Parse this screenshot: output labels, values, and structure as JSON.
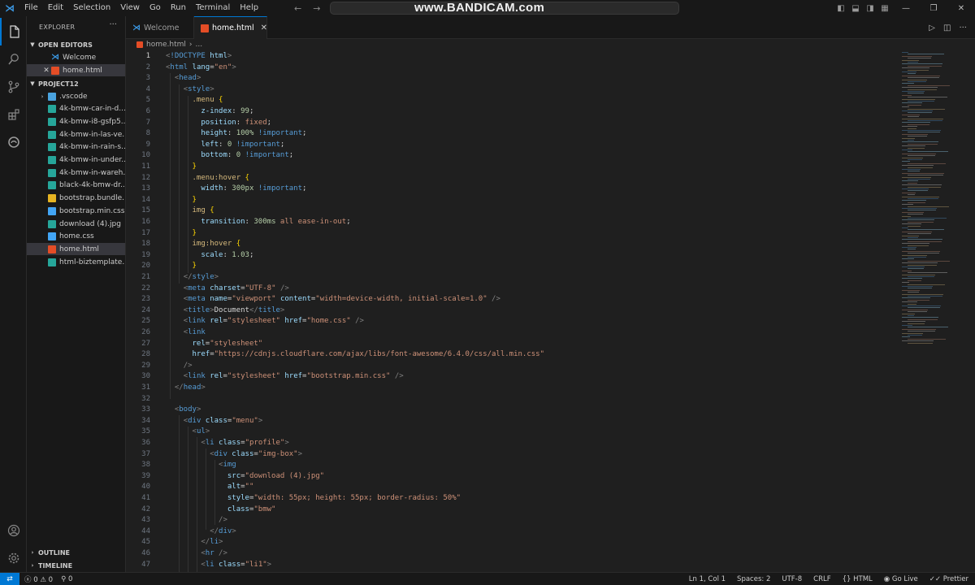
{
  "watermark": "www.BANDICAM.com",
  "menu": [
    "File",
    "Edit",
    "Selection",
    "View",
    "Go",
    "Run",
    "Terminal",
    "Help"
  ],
  "colors": {
    "accent": "#0078d4",
    "editor_bg": "#1f1f1f",
    "chrome_bg": "#181818"
  },
  "icons": {
    "activity": [
      "explorer-icon",
      "search-icon",
      "source-control-icon",
      "extensions-icon",
      "edge-icon",
      "account-icon",
      "settings-gear-icon"
    ]
  },
  "sidebar": {
    "title": "EXPLORER",
    "more": "···",
    "open_editors_label": "OPEN EDITORS",
    "open_editors": [
      {
        "name": "Welcome",
        "icon": "vscode-icon",
        "close": ""
      },
      {
        "name": "home.html",
        "icon": "html-file-icon",
        "close": "✕"
      }
    ],
    "project_label": "PROJECT12",
    "files": [
      {
        "name": ".vscode",
        "kind": "folder"
      },
      {
        "name": "4k-bmw-car-in-d...",
        "kind": "jpg"
      },
      {
        "name": "4k-bmw-i8-gsfp5...",
        "kind": "jpg"
      },
      {
        "name": "4k-bmw-in-las-ve...",
        "kind": "jpg"
      },
      {
        "name": "4k-bmw-in-rain-s...",
        "kind": "jpg"
      },
      {
        "name": "4k-bmw-in-under...",
        "kind": "jpg"
      },
      {
        "name": "4k-bmw-in-wareh...",
        "kind": "jpg"
      },
      {
        "name": "black-4k-bmw-dr...",
        "kind": "jpg"
      },
      {
        "name": "bootstrap.bundle....",
        "kind": "js"
      },
      {
        "name": "bootstrap.min.css",
        "kind": "css"
      },
      {
        "name": "download (4).jpg",
        "kind": "jpg"
      },
      {
        "name": "home.css",
        "kind": "css"
      },
      {
        "name": "home.html",
        "kind": "html"
      },
      {
        "name": "html-biztemplate....",
        "kind": "jpg"
      }
    ],
    "outline_label": "OUTLINE",
    "timeline_label": "TIMELINE"
  },
  "tabs": [
    {
      "label": "Welcome",
      "close": ""
    },
    {
      "label": "home.html",
      "close": "✕"
    }
  ],
  "breadcrumb": {
    "file": "home.html",
    "sep": "›",
    "rest": "..."
  },
  "editor": {
    "current_line": 1,
    "lines": [
      [
        [
          "t-pu",
          "<"
        ],
        [
          "t-dt",
          "!DOCTYPE"
        ],
        [
          "t-txt",
          " "
        ],
        [
          "t-attr",
          "html"
        ],
        [
          "t-pu",
          ">"
        ]
      ],
      [
        [
          "t-pu",
          "<"
        ],
        [
          "t-tag",
          "html"
        ],
        [
          "t-txt",
          " "
        ],
        [
          "t-attr",
          "lang"
        ],
        [
          "t-txt",
          "="
        ],
        [
          "t-str",
          "\"en\""
        ],
        [
          "t-pu",
          ">"
        ]
      ],
      [
        [
          "t-txt",
          "  "
        ],
        [
          "t-pu",
          "<"
        ],
        [
          "t-tag",
          "head"
        ],
        [
          "t-pu",
          ">"
        ]
      ],
      [
        [
          "t-txt",
          "    "
        ],
        [
          "t-pu",
          "<"
        ],
        [
          "t-tag",
          "style"
        ],
        [
          "t-pu",
          ">"
        ]
      ],
      [
        [
          "t-txt",
          "      "
        ],
        [
          "t-sel",
          ".menu"
        ],
        [
          "t-txt",
          " "
        ],
        [
          "t-br",
          "{"
        ]
      ],
      [
        [
          "t-txt",
          "        "
        ],
        [
          "t-prop",
          "z-index"
        ],
        [
          "t-txt",
          ": "
        ],
        [
          "t-num",
          "99"
        ],
        [
          "t-txt",
          ";"
        ]
      ],
      [
        [
          "t-txt",
          "        "
        ],
        [
          "t-prop",
          "position"
        ],
        [
          "t-txt",
          ": "
        ],
        [
          "t-str",
          "fixed"
        ],
        [
          "t-txt",
          ";"
        ]
      ],
      [
        [
          "t-txt",
          "        "
        ],
        [
          "t-prop",
          "height"
        ],
        [
          "t-txt",
          ": "
        ],
        [
          "t-num",
          "100%"
        ],
        [
          "t-txt",
          " "
        ],
        [
          "t-imp",
          "!important"
        ],
        [
          "t-txt",
          ";"
        ]
      ],
      [
        [
          "t-txt",
          "        "
        ],
        [
          "t-prop",
          "left"
        ],
        [
          "t-txt",
          ": "
        ],
        [
          "t-num",
          "0"
        ],
        [
          "t-txt",
          " "
        ],
        [
          "t-imp",
          "!important"
        ],
        [
          "t-txt",
          ";"
        ]
      ],
      [
        [
          "t-txt",
          "        "
        ],
        [
          "t-prop",
          "bottom"
        ],
        [
          "t-txt",
          ": "
        ],
        [
          "t-num",
          "0"
        ],
        [
          "t-txt",
          " "
        ],
        [
          "t-imp",
          "!important"
        ],
        [
          "t-txt",
          ";"
        ]
      ],
      [
        [
          "t-txt",
          "      "
        ],
        [
          "t-br",
          "}"
        ]
      ],
      [
        [
          "t-txt",
          "      "
        ],
        [
          "t-sel",
          ".menu:hover"
        ],
        [
          "t-txt",
          " "
        ],
        [
          "t-br",
          "{"
        ]
      ],
      [
        [
          "t-txt",
          "        "
        ],
        [
          "t-prop",
          "width"
        ],
        [
          "t-txt",
          ": "
        ],
        [
          "t-num",
          "300px"
        ],
        [
          "t-txt",
          " "
        ],
        [
          "t-imp",
          "!important"
        ],
        [
          "t-txt",
          ";"
        ]
      ],
      [
        [
          "t-txt",
          "      "
        ],
        [
          "t-br",
          "}"
        ]
      ],
      [
        [
          "t-txt",
          "      "
        ],
        [
          "t-sel",
          "img"
        ],
        [
          "t-txt",
          " "
        ],
        [
          "t-br",
          "{"
        ]
      ],
      [
        [
          "t-txt",
          "        "
        ],
        [
          "t-prop",
          "transition"
        ],
        [
          "t-txt",
          ": "
        ],
        [
          "t-num",
          "300ms"
        ],
        [
          "t-txt",
          " "
        ],
        [
          "t-str",
          "all ease-in-out"
        ],
        [
          "t-txt",
          ";"
        ]
      ],
      [
        [
          "t-txt",
          "      "
        ],
        [
          "t-br",
          "}"
        ]
      ],
      [
        [
          "t-txt",
          "      "
        ],
        [
          "t-sel",
          "img:hover"
        ],
        [
          "t-txt",
          " "
        ],
        [
          "t-br",
          "{"
        ]
      ],
      [
        [
          "t-txt",
          "        "
        ],
        [
          "t-prop",
          "scale"
        ],
        [
          "t-txt",
          ": "
        ],
        [
          "t-num",
          "1.03"
        ],
        [
          "t-txt",
          ";"
        ]
      ],
      [
        [
          "t-txt",
          "      "
        ],
        [
          "t-br",
          "}"
        ]
      ],
      [
        [
          "t-txt",
          "    "
        ],
        [
          "t-pu",
          "</"
        ],
        [
          "t-tag",
          "style"
        ],
        [
          "t-pu",
          ">"
        ]
      ],
      [
        [
          "t-txt",
          "    "
        ],
        [
          "t-pu",
          "<"
        ],
        [
          "t-tag",
          "meta"
        ],
        [
          "t-txt",
          " "
        ],
        [
          "t-attr",
          "charset"
        ],
        [
          "t-txt",
          "="
        ],
        [
          "t-str",
          "\"UTF-8\""
        ],
        [
          "t-txt",
          " "
        ],
        [
          "t-pu",
          "/>"
        ]
      ],
      [
        [
          "t-txt",
          "    "
        ],
        [
          "t-pu",
          "<"
        ],
        [
          "t-tag",
          "meta"
        ],
        [
          "t-txt",
          " "
        ],
        [
          "t-attr",
          "name"
        ],
        [
          "t-txt",
          "="
        ],
        [
          "t-str",
          "\"viewport\""
        ],
        [
          "t-txt",
          " "
        ],
        [
          "t-attr",
          "content"
        ],
        [
          "t-txt",
          "="
        ],
        [
          "t-str",
          "\"width=device-width, initial-scale=1.0\""
        ],
        [
          "t-txt",
          " "
        ],
        [
          "t-pu",
          "/>"
        ]
      ],
      [
        [
          "t-txt",
          "    "
        ],
        [
          "t-pu",
          "<"
        ],
        [
          "t-tag",
          "title"
        ],
        [
          "t-pu",
          ">"
        ],
        [
          "t-txt",
          "Document"
        ],
        [
          "t-pu",
          "</"
        ],
        [
          "t-tag",
          "title"
        ],
        [
          "t-pu",
          ">"
        ]
      ],
      [
        [
          "t-txt",
          "    "
        ],
        [
          "t-pu",
          "<"
        ],
        [
          "t-tag",
          "link"
        ],
        [
          "t-txt",
          " "
        ],
        [
          "t-attr",
          "rel"
        ],
        [
          "t-txt",
          "="
        ],
        [
          "t-str",
          "\"stylesheet\""
        ],
        [
          "t-txt",
          " "
        ],
        [
          "t-attr",
          "href"
        ],
        [
          "t-txt",
          "="
        ],
        [
          "t-str",
          "\"home.css\""
        ],
        [
          "t-txt",
          " "
        ],
        [
          "t-pu",
          "/>"
        ]
      ],
      [
        [
          "t-txt",
          "    "
        ],
        [
          "t-pu",
          "<"
        ],
        [
          "t-tag",
          "link"
        ]
      ],
      [
        [
          "t-txt",
          "      "
        ],
        [
          "t-attr",
          "rel"
        ],
        [
          "t-txt",
          "="
        ],
        [
          "t-str",
          "\"stylesheet\""
        ]
      ],
      [
        [
          "t-txt",
          "      "
        ],
        [
          "t-attr",
          "href"
        ],
        [
          "t-txt",
          "="
        ],
        [
          "t-str",
          "\"https://cdnjs.cloudflare.com/ajax/libs/font-awesome/6.4.0/css/all.min.css\""
        ]
      ],
      [
        [
          "t-txt",
          "    "
        ],
        [
          "t-pu",
          "/>"
        ]
      ],
      [
        [
          "t-txt",
          "    "
        ],
        [
          "t-pu",
          "<"
        ],
        [
          "t-tag",
          "link"
        ],
        [
          "t-txt",
          " "
        ],
        [
          "t-attr",
          "rel"
        ],
        [
          "t-txt",
          "="
        ],
        [
          "t-str",
          "\"stylesheet\""
        ],
        [
          "t-txt",
          " "
        ],
        [
          "t-attr",
          "href"
        ],
        [
          "t-txt",
          "="
        ],
        [
          "t-str",
          "\"bootstrap.min.css\""
        ],
        [
          "t-txt",
          " "
        ],
        [
          "t-pu",
          "/>"
        ]
      ],
      [
        [
          "t-txt",
          "  "
        ],
        [
          "t-pu",
          "</"
        ],
        [
          "t-tag",
          "head"
        ],
        [
          "t-pu",
          ">"
        ]
      ],
      [
        [
          "t-txt",
          ""
        ]
      ],
      [
        [
          "t-txt",
          "  "
        ],
        [
          "t-pu",
          "<"
        ],
        [
          "t-tag",
          "body"
        ],
        [
          "t-pu",
          ">"
        ]
      ],
      [
        [
          "t-txt",
          "    "
        ],
        [
          "t-pu",
          "<"
        ],
        [
          "t-tag",
          "div"
        ],
        [
          "t-txt",
          " "
        ],
        [
          "t-attr",
          "class"
        ],
        [
          "t-txt",
          "="
        ],
        [
          "t-str",
          "\"menu\""
        ],
        [
          "t-pu",
          ">"
        ]
      ],
      [
        [
          "t-txt",
          "      "
        ],
        [
          "t-pu",
          "<"
        ],
        [
          "t-tag",
          "ul"
        ],
        [
          "t-pu",
          ">"
        ]
      ],
      [
        [
          "t-txt",
          "        "
        ],
        [
          "t-pu",
          "<"
        ],
        [
          "t-tag",
          "li"
        ],
        [
          "t-txt",
          " "
        ],
        [
          "t-attr",
          "class"
        ],
        [
          "t-txt",
          "="
        ],
        [
          "t-str",
          "\"profile\""
        ],
        [
          "t-pu",
          ">"
        ]
      ],
      [
        [
          "t-txt",
          "          "
        ],
        [
          "t-pu",
          "<"
        ],
        [
          "t-tag",
          "div"
        ],
        [
          "t-txt",
          " "
        ],
        [
          "t-attr",
          "class"
        ],
        [
          "t-txt",
          "="
        ],
        [
          "t-str",
          "\"img-box\""
        ],
        [
          "t-pu",
          ">"
        ]
      ],
      [
        [
          "t-txt",
          "            "
        ],
        [
          "t-pu",
          "<"
        ],
        [
          "t-tag",
          "img"
        ]
      ],
      [
        [
          "t-txt",
          "              "
        ],
        [
          "t-attr",
          "src"
        ],
        [
          "t-txt",
          "="
        ],
        [
          "t-str",
          "\"download (4).jpg\""
        ]
      ],
      [
        [
          "t-txt",
          "              "
        ],
        [
          "t-attr",
          "alt"
        ],
        [
          "t-txt",
          "="
        ],
        [
          "t-str",
          "\"\""
        ]
      ],
      [
        [
          "t-txt",
          "              "
        ],
        [
          "t-attr",
          "style"
        ],
        [
          "t-txt",
          "="
        ],
        [
          "t-str",
          "\"width: 55px; height: 55px; border-radius: 50%\""
        ]
      ],
      [
        [
          "t-txt",
          "              "
        ],
        [
          "t-attr",
          "class"
        ],
        [
          "t-txt",
          "="
        ],
        [
          "t-str",
          "\"bmw\""
        ]
      ],
      [
        [
          "t-txt",
          "            "
        ],
        [
          "t-pu",
          "/>"
        ]
      ],
      [
        [
          "t-txt",
          "          "
        ],
        [
          "t-pu",
          "</"
        ],
        [
          "t-tag",
          "div"
        ],
        [
          "t-pu",
          ">"
        ]
      ],
      [
        [
          "t-txt",
          "        "
        ],
        [
          "t-pu",
          "</"
        ],
        [
          "t-tag",
          "li"
        ],
        [
          "t-pu",
          ">"
        ]
      ],
      [
        [
          "t-txt",
          "        "
        ],
        [
          "t-pu",
          "<"
        ],
        [
          "t-tag",
          "hr"
        ],
        [
          "t-txt",
          " "
        ],
        [
          "t-pu",
          "/>"
        ]
      ],
      [
        [
          "t-txt",
          "        "
        ],
        [
          "t-pu",
          "<"
        ],
        [
          "t-tag",
          "li"
        ],
        [
          "t-txt",
          " "
        ],
        [
          "t-attr",
          "class"
        ],
        [
          "t-txt",
          "="
        ],
        [
          "t-str",
          "\"li1\""
        ],
        [
          "t-pu",
          ">"
        ]
      ]
    ]
  },
  "status": {
    "errors": "0",
    "warnings": "0",
    "ports": "0",
    "position": "Ln 1, Col 1",
    "spaces": "Spaces: 2",
    "encoding": "UTF-8",
    "eol": "CRLF",
    "language": "HTML",
    "golive": "Go Live",
    "prettier": "Prettier"
  }
}
